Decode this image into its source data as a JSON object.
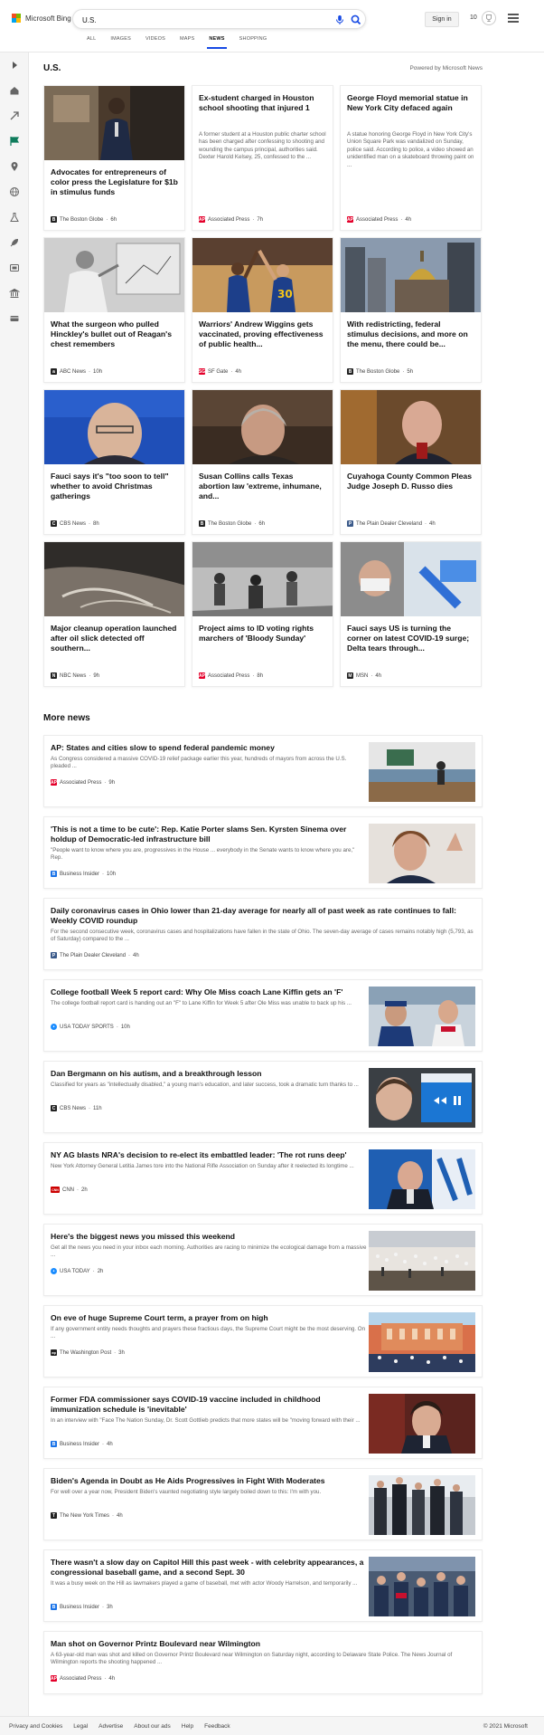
{
  "header": {
    "logo_text": "Microsoft Bing",
    "query": "U.S.",
    "sign_in": "Sign in",
    "rewards_count": "10"
  },
  "scope_tabs": [
    {
      "label": "ALL",
      "active": false
    },
    {
      "label": "IMAGES",
      "active": false
    },
    {
      "label": "VIDEOS",
      "active": false
    },
    {
      "label": "MAPS",
      "active": false
    },
    {
      "label": "NEWS",
      "active": true
    },
    {
      "label": "SHOPPING",
      "active": false
    }
  ],
  "section": {
    "title": "U.S.",
    "powered_by": "Powered by Microsoft News"
  },
  "grid_cards": [
    {
      "title": "Advocates for entrepreneurs of color press the Legislature for $1b in stimulus funds",
      "snippet": "",
      "provider": "The Boston Globe",
      "age": "6h",
      "logo": "B",
      "logo_color": "#222222"
    },
    {
      "title": "Ex-student charged in Houston school shooting that injured 1",
      "snippet": "A former student at a Houston public charter school has been charged after confessing to shooting and wounding the campus principal, authorities said. Dexter Harold Kelsey, 25, confessed to the ...",
      "provider": "Associated Press",
      "age": "7h",
      "logo": "AP",
      "logo_color": "#e4002b"
    },
    {
      "title": "George Floyd memorial statue in New York City defaced again",
      "snippet": "A statue honoring George Floyd in New York City's Union Square Park was vandalized on Sunday, police said. According to police, a video showed an unidentified man on a skateboard throwing paint on ...",
      "provider": "Associated Press",
      "age": "4h",
      "logo": "AP",
      "logo_color": "#e4002b"
    },
    {
      "title": "What the surgeon who pulled Hinckley's bullet out of Reagan's chest remembers",
      "snippet": "",
      "provider": "ABC News",
      "age": "10h",
      "logo": "a",
      "logo_color": "#222222"
    },
    {
      "title": "Warriors' Andrew Wiggins gets vaccinated, proving effectiveness of public health...",
      "snippet": "",
      "provider": "SF Gate",
      "age": "4h",
      "logo": "SG",
      "logo_color": "#e4002b"
    },
    {
      "title": "With redistricting, federal stimulus decisions, and more on the menu, there could be...",
      "snippet": "",
      "provider": "The Boston Globe",
      "age": "5h",
      "logo": "B",
      "logo_color": "#222222"
    },
    {
      "title": "Fauci says it's \"too soon to tell\" whether to avoid Christmas gatherings",
      "snippet": "",
      "provider": "CBS News",
      "age": "8h",
      "logo": "C",
      "logo_color": "#222222"
    },
    {
      "title": "Susan Collins calls Texas abortion law 'extreme, inhumane, and...",
      "snippet": "",
      "provider": "The Boston Globe",
      "age": "6h",
      "logo": "B",
      "logo_color": "#222222"
    },
    {
      "title": "Cuyahoga County Common Pleas Judge Joseph D. Russo dies",
      "snippet": "",
      "provider": "The Plain Dealer Cleveland",
      "age": "4h",
      "logo": "P",
      "logo_color": "#3b5a8a"
    },
    {
      "title": "Major cleanup operation launched after oil slick detected off southern...",
      "snippet": "",
      "provider": "NBC News",
      "age": "9h",
      "logo": "N",
      "logo_color": "#222222"
    },
    {
      "title": "Project aims to ID voting rights marchers of 'Bloody Sunday'",
      "snippet": "",
      "provider": "Associated Press",
      "age": "8h",
      "logo": "AP",
      "logo_color": "#e4002b"
    },
    {
      "title": "Fauci says US is turning the corner on latest COVID-19 surge; Delta tears through...",
      "snippet": "",
      "provider": "MSN",
      "age": "4h",
      "logo": "M",
      "logo_color": "#222222"
    }
  ],
  "more_news": {
    "title": "More news",
    "items": [
      {
        "title": "AP: States and cities slow to spend federal pandemic money",
        "snippet": "As Congress considered a massive COVID-19 relief package earlier this year, hundreds of mayors from across the U.S. pleaded ...",
        "provider": "Associated Press",
        "age": "9h",
        "logo": "AP",
        "logo_color": "#e4002b"
      },
      {
        "title": "'This is not a time to be cute': Rep. Katie Porter slams Sen. Kyrsten Sinema over holdup of Democratic-led infrastructure bill",
        "snippet": "\"People want to know where you are, progressives in the House ... everybody in the Senate wants to know where you are,\" Rep.",
        "provider": "Business Insider",
        "age": "10h",
        "logo": "B",
        "logo_color": "#1a73e8"
      },
      {
        "title": "Daily coronavirus cases in Ohio lower than 21-day average for nearly all of past week as rate continues to fall: Weekly COVID roundup",
        "snippet": "For the second consecutive week, coronavirus cases and hospitalizations have fallen in the state of Ohio. The seven-day average of cases remains notably high (5,793, as of Saturday) compared to the ...",
        "provider": "The Plain Dealer Cleveland",
        "age": "4h",
        "logo": "P",
        "logo_color": "#3b5a8a"
      },
      {
        "title": "College football Week 5 report card: Why Ole Miss coach Lane Kiffin gets an 'F'",
        "snippet": "The college football report card is handing out an \"F\" to Lane Kiffin for Week 5 after Ole Miss was unable to back up his ...",
        "provider": "USA TODAY SPORTS",
        "age": "10h",
        "logo": "•",
        "logo_color": "#1a8cff"
      },
      {
        "title": "Dan Bergmann on his autism, and a breakthrough lesson",
        "snippet": "Classified for years as \"intellectually disabled,\" a young man's education, and later success, took a dramatic turn thanks to ...",
        "provider": "CBS News",
        "age": "11h",
        "logo": "C",
        "logo_color": "#222222"
      },
      {
        "title": "NY AG blasts NRA's decision to re-elect its embattled leader: 'The rot runs deep'",
        "snippet": "New York Attorney General Letitia James tore into the National Rifle Association on Sunday after it reelected its longtime ...",
        "provider": "CNN",
        "age": "2h",
        "logo": "CNN",
        "logo_color": "#cc0000"
      },
      {
        "title": "Here's the biggest news you missed this weekend",
        "snippet": "Get all the news you need in your inbox each morning. Authorities are racing to minimize the ecological damage from a massive ...",
        "provider": "USA TODAY",
        "age": "2h",
        "logo": "•",
        "logo_color": "#1a8cff"
      },
      {
        "title": "On eve of huge Supreme Court term, a prayer from on high",
        "snippet": "If any government entity needs thoughts and prayers these fractious days, the Supreme Court might be the most deserving. On ...",
        "provider": "The Washington Post",
        "age": "3h",
        "logo": "wp",
        "logo_color": "#222222"
      },
      {
        "title": "Former FDA commissioner says COVID-19 vaccine included in childhood immunization schedule is 'inevitable'",
        "snippet": "In an interview with \"Face The Nation Sunday, Dr. Scott Gottlieb predicts that more states will be \"moving forward with their ...",
        "provider": "Business Insider",
        "age": "4h",
        "logo": "B",
        "logo_color": "#1a73e8"
      },
      {
        "title": "Biden's Agenda in Doubt as He Aids Progressives in Fight With Moderates",
        "snippet": "For well over a year now, President Biden's vaunted negotiating style largely boiled down to this: I'm with you.",
        "provider": "The New York Times",
        "age": "4h",
        "logo": "T",
        "logo_color": "#222222"
      },
      {
        "title": "There wasn't a slow day on Capitol Hill this past week - with celebrity appearances, a congressional baseball game, and a second Sept. 30",
        "snippet": "It was a busy week on the Hill as lawmakers played a game of baseball, met with actor Woody Harrelson, and temporarily ...",
        "provider": "Business Insider",
        "age": "3h",
        "logo": "B",
        "logo_color": "#1a73e8"
      },
      {
        "title": "Man shot on Governor Printz Boulevard near Wilmington",
        "snippet": "A 63-year-old man was shot and killed on Governor Printz Boulevard near Wilmington on Saturday night, according to Delaware State Police. The News Journal of Wilmington reports the shooting happened ...",
        "provider": "Associated Press",
        "age": "4h",
        "logo": "AP",
        "logo_color": "#e4002b"
      }
    ]
  },
  "footer": {
    "links": [
      "Privacy and Cookies",
      "Legal",
      "Advertise",
      "About our ads",
      "Help",
      "Feedback"
    ],
    "copyright": "© 2021 Microsoft"
  },
  "colors": {
    "accent": "#174ae4",
    "logo_red": "#f25022",
    "logo_green": "#7fba00",
    "logo_blue": "#00a4ef",
    "logo_yellow": "#ffb900"
  }
}
